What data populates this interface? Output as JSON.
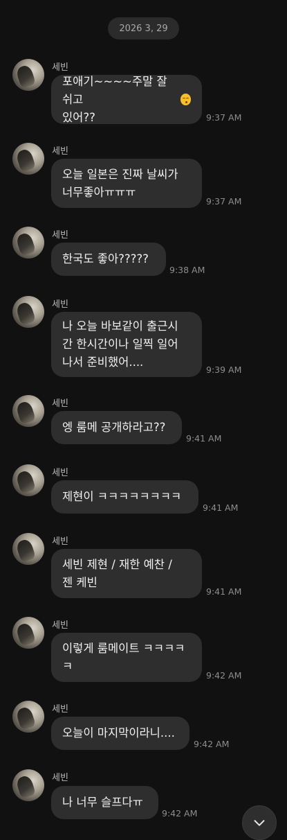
{
  "date_divider": "2026 3, 29",
  "sender_name": "세빈",
  "messages": [
    {
      "text": "포애기~~~~주말 잘 쉬고\n있어??",
      "emoji": "kissing-face-emoji",
      "time": "9:37 AM"
    },
    {
      "text": "오늘 일본은 진짜 날씨가\n너무좋아ㅠㅠㅠ",
      "time": "9:37 AM"
    },
    {
      "text": "한국도 좋아?????",
      "time": "9:38 AM"
    },
    {
      "text": "나 오늘 바보같이 출근시\n간 한시간이나 일찍 일어\n나서 준비했어....",
      "time": "9:39 AM"
    },
    {
      "text": "엥 룸메 공개하라고??",
      "time": "9:41 AM"
    },
    {
      "text": "제현이 ㅋㅋㅋㅋㅋㅋㅋㅋ",
      "time": "9:41 AM"
    },
    {
      "text": "세빈 제현 / 재한 예찬 /\n젠 케빈",
      "time": "9:41 AM"
    },
    {
      "text": "이렇게 룸메이트 ㅋㅋㅋㅋ\nㅋ",
      "time": "9:42 AM"
    },
    {
      "text": "오늘이 마지막이라니....",
      "time": "9:42 AM"
    },
    {
      "text": "나 너무 슬프다ㅠ",
      "time": "9:42 AM"
    }
  ],
  "scroll_button_icon": "chevron-down-icon"
}
